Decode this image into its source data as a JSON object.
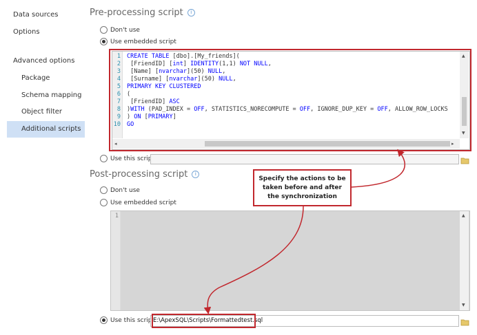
{
  "nav": {
    "data_sources": "Data sources",
    "options": "Options",
    "advanced_options": "Advanced options",
    "package": "Package",
    "schema_mapping": "Schema mapping",
    "object_filter": "Object filter",
    "additional_scripts": "Additional scripts"
  },
  "pre": {
    "title": "Pre-processing script",
    "dont_use": "Don't use",
    "use_embedded": "Use embedded script",
    "use_this": "Use this script:",
    "selected": "use_embedded",
    "line_numbers": [
      "1",
      "2",
      "3",
      "4",
      "5",
      "6",
      "7",
      "8",
      "9",
      "10"
    ],
    "code_lines": [
      "CREATE TABLE [dbo].[My_friends](",
      " [FriendID] [int] IDENTITY(1,1) NOT NULL,",
      " [Name] [nvarchar](50) NULL,",
      " [Surname] [nvarchar](50) NULL,",
      "PRIMARY KEY CLUSTERED",
      "(",
      " [FriendID] ASC",
      ")WITH (PAD_INDEX = OFF, STATISTICS_NORECOMPUTE = OFF, IGNORE_DUP_KEY = OFF, ALLOW_ROW_LOCKS",
      ") ON [PRIMARY]",
      "GO"
    ]
  },
  "post": {
    "title": "Post-processing script",
    "dont_use": "Don't use",
    "use_embedded": "Use embedded script",
    "use_this": "Use this script:",
    "selected": "use_this",
    "line_numbers": [
      "1"
    ],
    "script_path": "E:\\ApexSQL\\Scripts\\Formattedtest.sql"
  },
  "callout": {
    "text": "Specify the actions to be taken before and after the synchronization"
  },
  "colors": {
    "highlight_red": "#c1272d",
    "keyword_blue": "#0000ff",
    "line_number": "#2b91af",
    "nav_selected": "#cfe0f5"
  }
}
